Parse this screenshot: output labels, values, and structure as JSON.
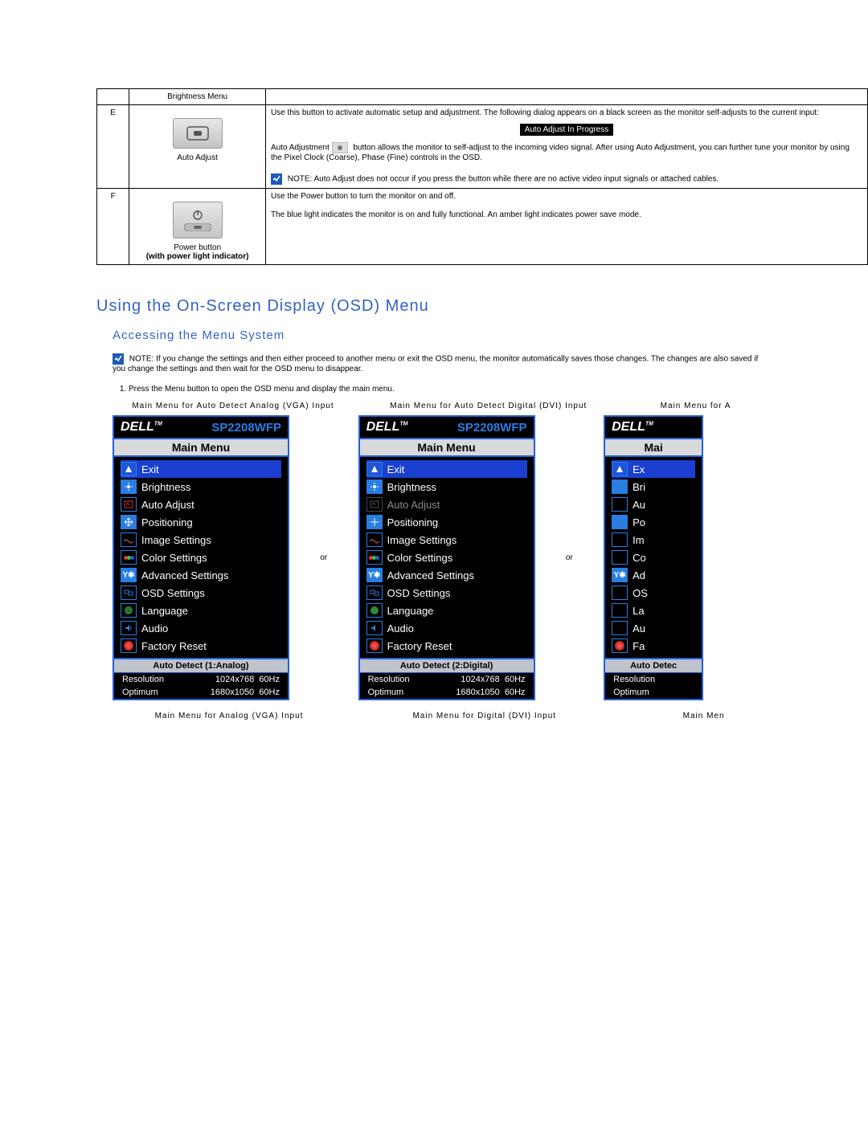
{
  "table": {
    "rowD": {
      "label": "Brightness Menu"
    },
    "rowE": {
      "letter": "E",
      "label": "Auto Adjust",
      "p1": "Use this button to activate automatic setup and adjustment. The following dialog appears on a black screen as the monitor self-adjusts to the current input:",
      "chip": "Auto Adjust In Progress",
      "p2a": "Auto Adjustment ",
      "p2b": " button allows the monitor to self-adjust to the incoming video signal. After using Auto Adjustment, you can further tune your monitor by using the Pixel Clock (Coarse), Phase (Fine) controls in the OSD.",
      "note": "NOTE: Auto Adjust does not occur if you press the button while there are no active video input signals or attached cables."
    },
    "rowF": {
      "letter": "F",
      "label1": "Power button",
      "label2": "(with power light indicator)",
      "p1": "Use the Power button to turn the monitor on and off.",
      "p2": "The blue light indicates the monitor is on and fully functional. An amber light indicates power save mode."
    }
  },
  "h2": "Using the On-Screen Display (OSD) Menu",
  "h3": "Accessing the Menu System",
  "note2": "NOTE: If you change the settings and then either proceed to another menu or exit the OSD menu, the monitor automatically saves those changes. The changes are also saved if you change the settings and then wait for the OSD menu to disappear.",
  "step1": "Press the Menu button to open the OSD menu and display the main menu.",
  "captions_top": {
    "c1": "Main Menu for Auto Detect Analog (VGA) Input",
    "c2": "Main Menu for Auto Detect Digital (DVI) Input",
    "c3": "Main Menu for A"
  },
  "or": "or",
  "osd": {
    "brand": "DELL",
    "tm": "TM",
    "model": "SP2208WFP",
    "title": "Main Menu",
    "items": {
      "exit": "Exit",
      "brightness": "Brightness",
      "auto": "Auto Adjust",
      "pos": "Positioning",
      "img": "Image Settings",
      "color": "Color Settings",
      "adv": "Advanced Settings",
      "osdset": "OSD Settings",
      "lang": "Language",
      "audio": "Audio",
      "reset": "Factory Reset"
    },
    "items_cut": {
      "exit": "Ex",
      "brightness": "Bri",
      "auto": "Au",
      "pos": "Po",
      "img": "Im",
      "color": "Co",
      "adv": "Ad",
      "osdset": "OS",
      "lang": "La",
      "audio": "Au",
      "reset": "Fa"
    },
    "status1": "Auto Detect (1:Analog)",
    "status2": "Auto Detect (2:Digital)",
    "status3": "Auto Detec",
    "title_cut": "Mai",
    "res_label": "Resolution",
    "res_val": "1024x768",
    "res_hz": "60Hz",
    "opt_label": "Optimum",
    "opt_val": "1680x1050",
    "opt_hz": "60Hz"
  },
  "captions_bottom": {
    "c1": "Main Menu for Analog (VGA) Input",
    "c2": "Main Menu for Digital (DVI) Input",
    "c3": "Main Men"
  }
}
